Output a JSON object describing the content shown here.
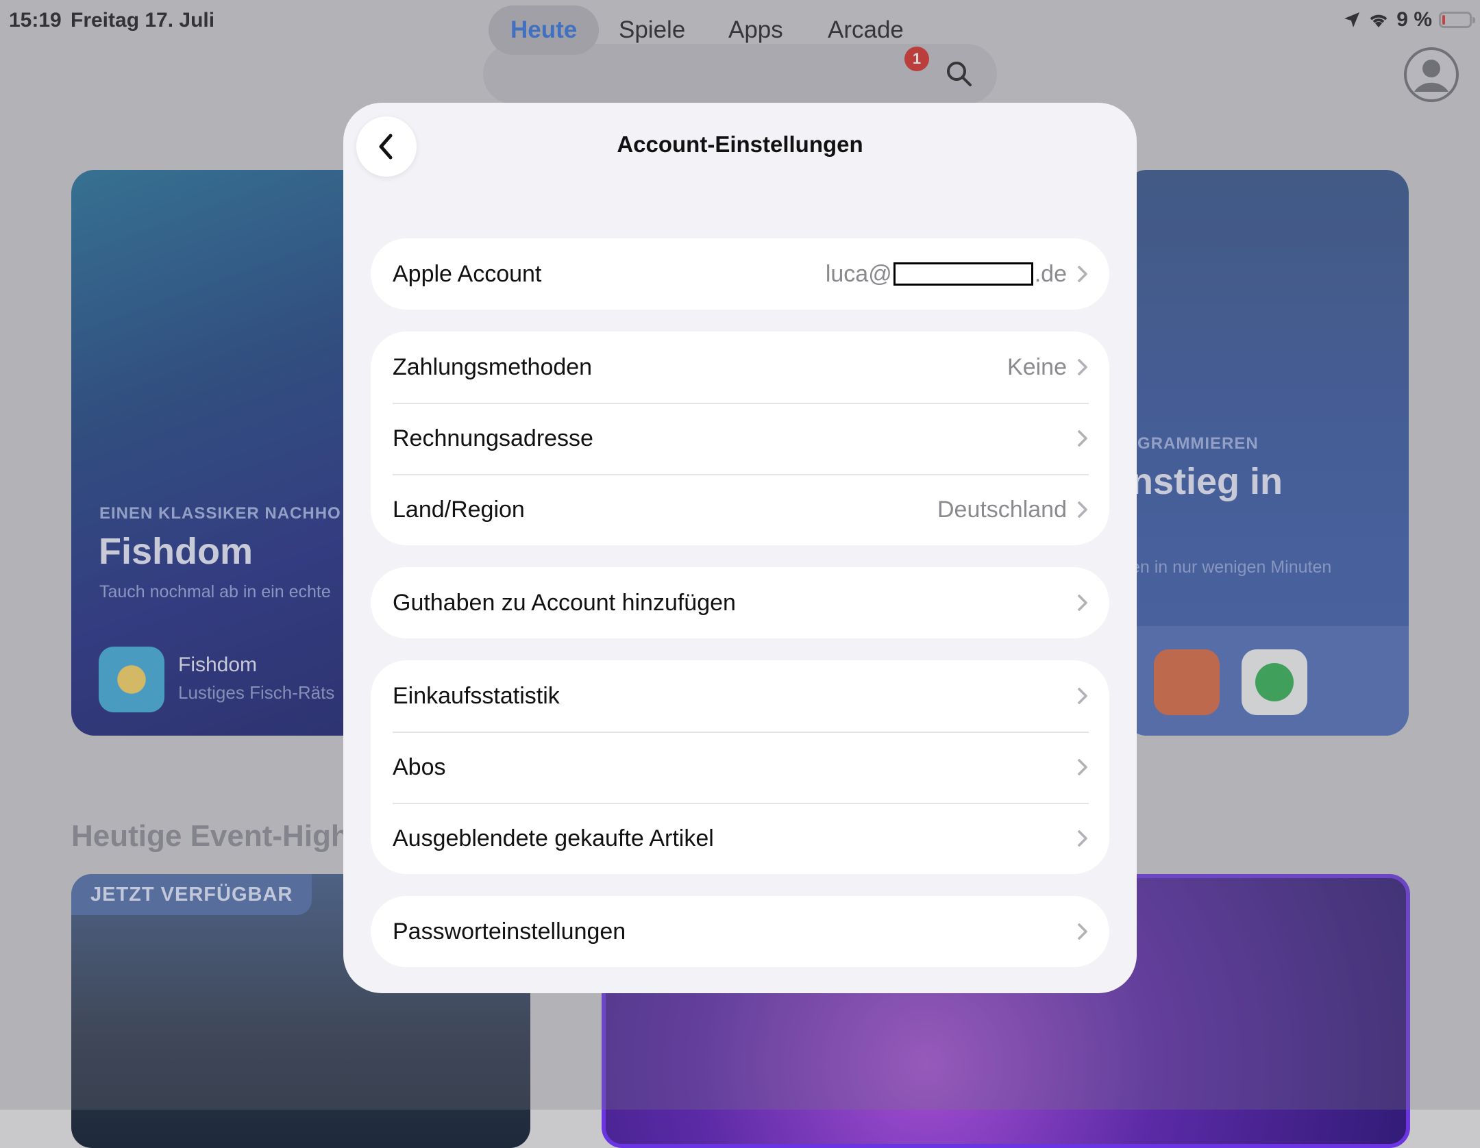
{
  "status_bar": {
    "time": "15:19",
    "date": "Freitag 17. Juli",
    "battery_text": "9 %",
    "battery_level_percent": 9
  },
  "tabs": [
    {
      "label": "Heute",
      "active": true
    },
    {
      "label": "Spiele",
      "active": false
    },
    {
      "label": "Apps",
      "active": false
    },
    {
      "label": "Arcade",
      "active": false
    }
  ],
  "arcade_badge": "1",
  "cards": {
    "left": {
      "eyebrow": "EINEN KLASSIKER NACHHO",
      "title": "Fishdom",
      "subtitle": "Tauch nochmal ab in ein echte",
      "app_name": "Fishdom",
      "app_sub": "Lustiges Fisch-Räts"
    },
    "right": {
      "eyebrow": "GRAMMIEREN",
      "title": "nstieg in",
      "subtitle": "en in nur wenigen Minuten"
    }
  },
  "event_section": {
    "title": "Heutige Event-High",
    "badge": "JETZT VERFÜGBAR"
  },
  "sheet": {
    "title": "Account-Einstellungen",
    "apple_account": {
      "label": "Apple Account",
      "value_prefix": "luca@",
      "value_suffix": ".de"
    },
    "payment": [
      {
        "label": "Zahlungsmethoden",
        "value": "Keine"
      },
      {
        "label": "Rechnungsadresse",
        "value": ""
      },
      {
        "label": "Land/Region",
        "value": "Deutschland"
      }
    ],
    "credit": {
      "label": "Guthaben zu Account hinzufügen"
    },
    "purchases": [
      {
        "label": "Einkaufsstatistik"
      },
      {
        "label": "Abos"
      },
      {
        "label": "Ausgeblendete gekaufte Artikel"
      }
    ],
    "password": {
      "label": "Passworteinstellungen"
    }
  },
  "colors": {
    "accent": "#2a6fd9",
    "badge": "#d52a22",
    "sheet_bg": "#f2f2f7",
    "secondary_text": "#8a8a8e"
  }
}
